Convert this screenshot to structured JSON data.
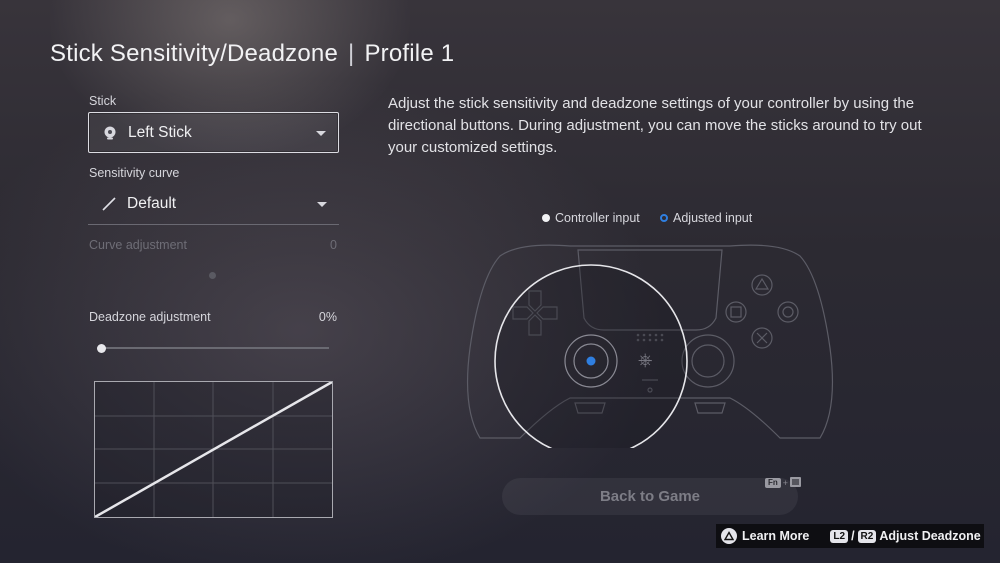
{
  "page": {
    "title": "Stick Sensitivity/Deadzone",
    "profile": "Profile 1"
  },
  "settings": {
    "stick_label": "Stick",
    "stick_value": "Left Stick",
    "curve_label": "Sensitivity curve",
    "curve_value": "Default",
    "curve_adjustment_label": "Curve adjustment",
    "curve_adjustment_value": "0",
    "deadzone_label": "Deadzone adjustment",
    "deadzone_value": "0%",
    "deadzone_level": 0
  },
  "description": "Adjust the stick sensitivity and deadzone settings of your controller by using the directional buttons. During adjustment, you can move the sticks around to try out your customized settings.",
  "legend": {
    "controller_input": "Controller input",
    "adjusted_input": "Adjusted input",
    "adjusted_color": "#2f7fe0"
  },
  "back_button": {
    "label": "Back to Game",
    "hint_key": "Fn"
  },
  "footer": {
    "learn_more": "Learn More",
    "l2": "L2",
    "separator": "/",
    "r2": "R2",
    "adjust_deadzone": "Adjust Deadzone"
  },
  "icons": {
    "stick": "left-stick-icon",
    "curve": "linear-curve-icon",
    "triangle": "triangle-button-icon",
    "menu": "menu-icon"
  }
}
